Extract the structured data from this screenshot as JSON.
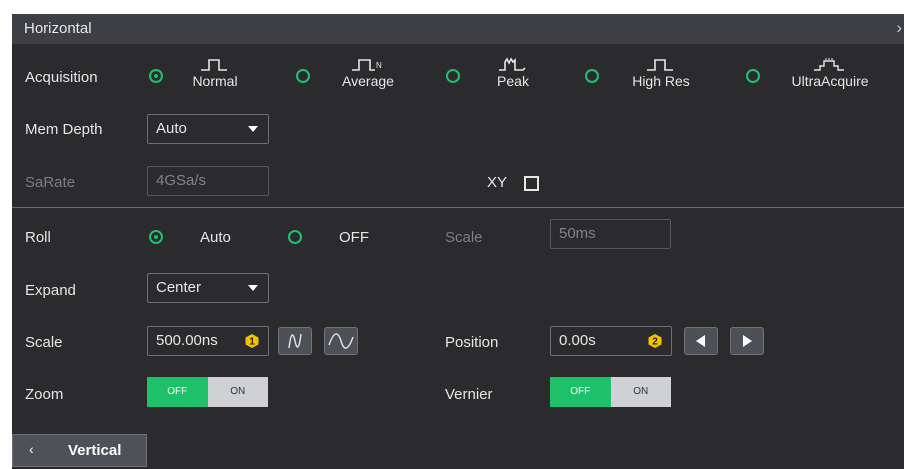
{
  "panel": {
    "title": "Horizontal",
    "close_glyph": "›"
  },
  "acquisition": {
    "label": "Acquisition",
    "selected": "Normal",
    "modes": [
      {
        "label": "Normal",
        "icon": "normal-waveform-icon",
        "selected": true
      },
      {
        "label": "Average",
        "icon": "average-waveform-icon",
        "selected": false
      },
      {
        "label": "Peak",
        "icon": "peak-waveform-icon",
        "selected": false
      },
      {
        "label": "High Res",
        "icon": "high-res-waveform-icon",
        "selected": false
      },
      {
        "label": "UltraAcquire",
        "icon": "ultraacquire-waveform-icon",
        "selected": false
      }
    ]
  },
  "mem_depth": {
    "label": "Mem Depth",
    "value": "Auto"
  },
  "sarate": {
    "label": "SaRate",
    "value": "4GSa/s"
  },
  "xy": {
    "label": "XY",
    "checked": false
  },
  "roll": {
    "label": "Roll",
    "selected": "Auto",
    "options": [
      {
        "label": "Auto",
        "selected": true
      },
      {
        "label": "OFF",
        "selected": false
      }
    ],
    "scale_label": "Scale",
    "scale_value": "50ms"
  },
  "expand": {
    "label": "Expand",
    "value": "Center"
  },
  "scale": {
    "label": "Scale",
    "value": "500.00ns",
    "knob": "1"
  },
  "position": {
    "label": "Position",
    "value": "0.00s",
    "knob": "2"
  },
  "zoom": {
    "label": "Zoom",
    "off_label": "OFF",
    "on_label": "ON",
    "state": "OFF"
  },
  "vernier": {
    "label": "Vernier",
    "off_label": "OFF",
    "on_label": "ON",
    "state": "OFF"
  },
  "nav": {
    "arrow": "‹",
    "label": "Vertical"
  },
  "colors": {
    "accent": "#21c06d",
    "panel_bg": "#2b2b2e",
    "titlebar_bg": "#3d3f44",
    "knob": "#f2c200"
  }
}
